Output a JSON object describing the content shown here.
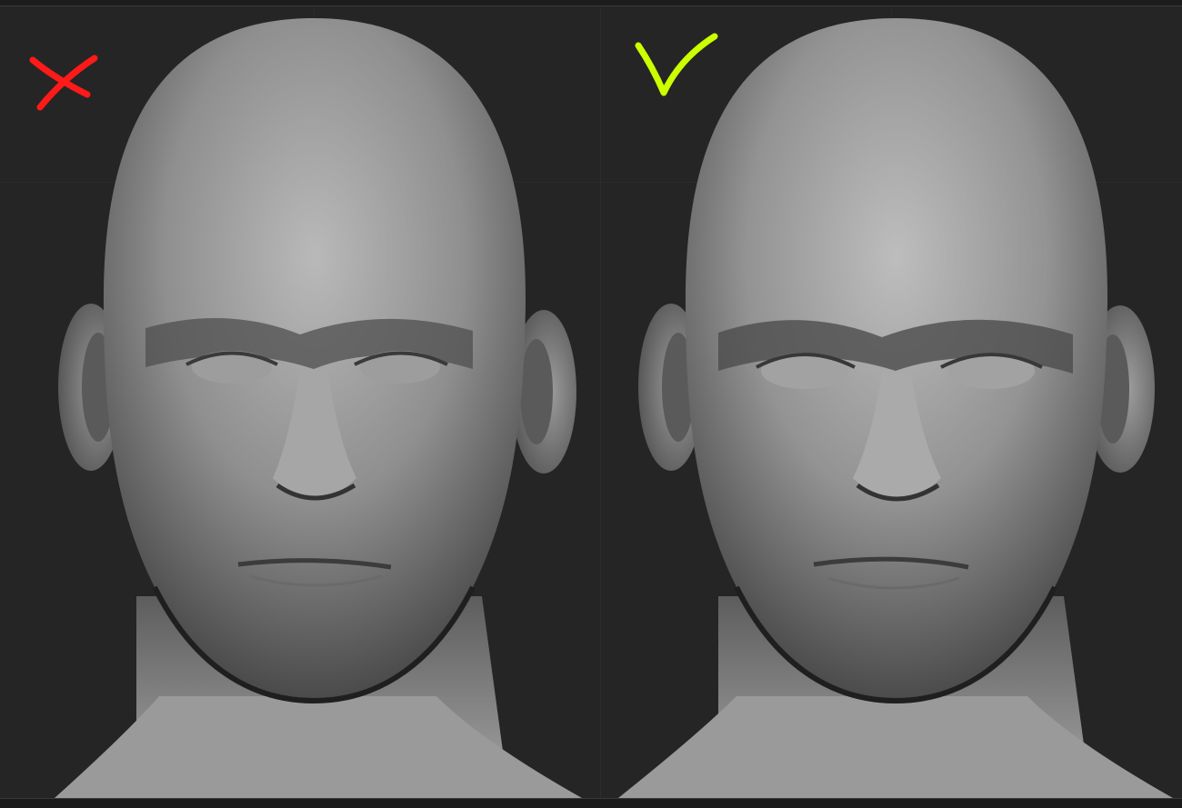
{
  "window": {
    "background": "#252525"
  },
  "panels": [
    {
      "id": "left",
      "verdict_icon": "cross-mark-icon",
      "verdict_color": "#ff1a1a"
    },
    {
      "id": "right",
      "verdict_icon": "check-mark-icon",
      "verdict_color": "#ccff00"
    }
  ],
  "model": {
    "material_color": "#8e8e8e",
    "shadow_color": "#3c3c3c",
    "highlight_color": "#c4c4c4"
  }
}
